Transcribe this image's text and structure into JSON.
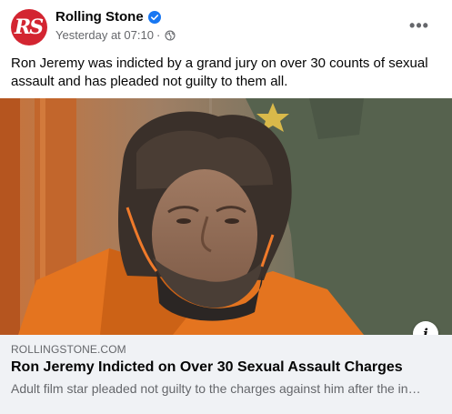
{
  "post": {
    "page_name": "Rolling Stone",
    "avatar_text": "RS",
    "timestamp": "Yesterday at 07:10",
    "separator": "·",
    "verified_icon": "verified-badge-icon",
    "privacy_icon": "globe-icon",
    "more_icon": "more-options-icon",
    "more_glyph": "•••",
    "caption": "Ron Jeremy was indicted by a grand jury on over 30 counts of sexual assault and has pleaded not guilty to them all."
  },
  "link_preview": {
    "domain": "ROLLINGSTONE.COM",
    "title": "Ron Jeremy Indicted on Over 30 Sexual Assault Charges",
    "description": "Adult film star pleaded not guilty to the charges against him after the in…",
    "info_glyph": "i",
    "info_icon": "info-icon"
  },
  "colors": {
    "brand_red": "#d32531",
    "verified_blue": "#1877f2",
    "secondary_text": "#65676b",
    "link_box_bg": "#f0f2f5"
  }
}
